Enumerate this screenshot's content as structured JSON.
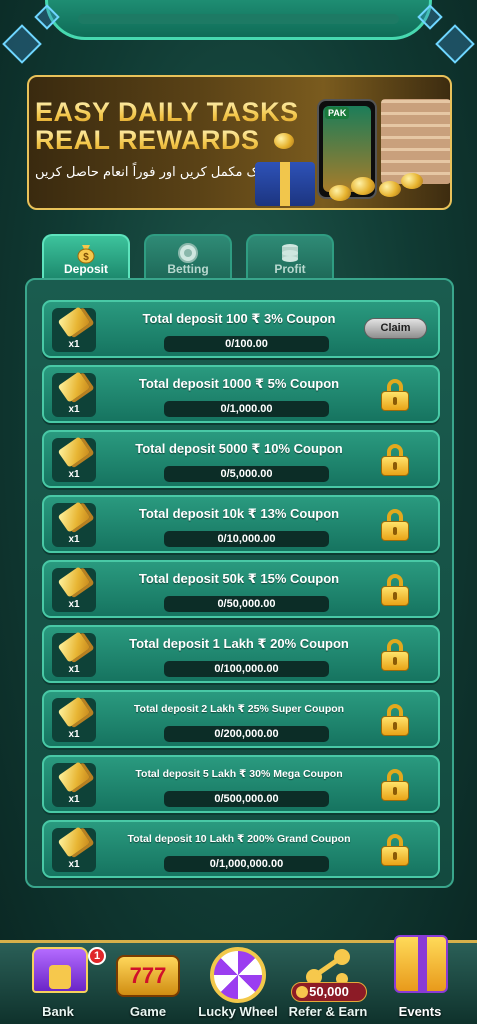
{
  "banner": {
    "line1": "EASY DAILY TASKS",
    "line2": "REAL REWARDS",
    "subtitle": "آج ایک مکمل کریں اور فوراً انعام حاصل کریں",
    "phone_label": "PAK"
  },
  "tabs": [
    {
      "label": "Deposit",
      "icon": "money-bag-icon",
      "active": true
    },
    {
      "label": "Betting",
      "icon": "chip-icon",
      "active": false
    },
    {
      "label": "Profit",
      "icon": "coin-stack-icon",
      "active": false
    }
  ],
  "tasks": [
    {
      "title": "Total deposit 100 ₹  3% Coupon",
      "progress": "0/100.00",
      "qty": "x1",
      "action": "Claim",
      "locked": false
    },
    {
      "title": "Total deposit 1000 ₹  5% Coupon",
      "progress": "0/1,000.00",
      "qty": "x1",
      "locked": true
    },
    {
      "title": "Total deposit 5000 ₹  10% Coupon",
      "progress": "0/5,000.00",
      "qty": "x1",
      "locked": true
    },
    {
      "title": "Total deposit 10k ₹  13% Coupon",
      "progress": "0/10,000.00",
      "qty": "x1",
      "locked": true
    },
    {
      "title": "Total deposit 50k ₹  15% Coupon",
      "progress": "0/50,000.00",
      "qty": "x1",
      "locked": true
    },
    {
      "title": "Total deposit 1 Lakh ₹  20% Coupon",
      "progress": "0/100,000.00",
      "qty": "x1",
      "locked": true
    },
    {
      "title": "Total deposit 2 Lakh ₹  25% Super Coupon",
      "progress": "0/200,000.00",
      "qty": "x1",
      "locked": true
    },
    {
      "title": "Total deposit 5 Lakh ₹  30% Mega Coupon",
      "progress": "0/500,000.00",
      "qty": "x1",
      "locked": true
    },
    {
      "title": "Total deposit 10 Lakh ₹  200% Grand Coupon",
      "progress": "0/1,000,000.00",
      "qty": "x1",
      "locked": true
    }
  ],
  "nav": {
    "bank": {
      "label": "Bank",
      "badge": "1"
    },
    "game": {
      "label": "Game",
      "icon_text": "777"
    },
    "lucky_wheel": {
      "label": "Lucky Wheel"
    },
    "refer_earn": {
      "label": "Refer & Earn",
      "amount": "50,000"
    },
    "events": {
      "label": "Events"
    }
  },
  "colors": {
    "accent": "#2a9a7f",
    "gold": "#e9c25a",
    "panel": "#1a5c4f"
  }
}
